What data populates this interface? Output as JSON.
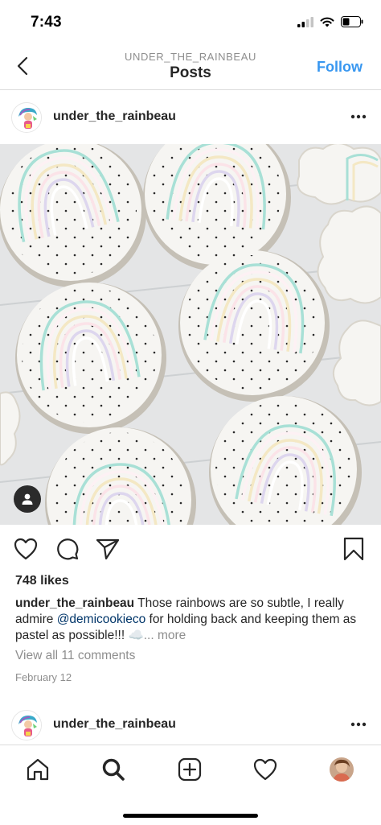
{
  "status_bar": {
    "time": "7:43"
  },
  "nav": {
    "subtitle": "UNDER_THE_RAINBEAU",
    "title": "Posts",
    "follow_label": "Follow"
  },
  "post": {
    "username": "under_the_rainbeau",
    "likes": "748 likes",
    "caption": {
      "username": "under_the_rainbeau",
      "text_before": " Those rainbows are so subtle, I really admire ",
      "mention": "@demicookieco",
      "text_after": " for holding back and keeping them as pastel as possible!!! ☁️",
      "more": "... more"
    },
    "view_comments": "View all 11 comments",
    "date": "February 12"
  },
  "next_post": {
    "username": "under_the_rainbeau"
  },
  "icons": {
    "back": "chevron-left-icon",
    "more": "more-horizontal-icon",
    "like": "heart-icon",
    "comment": "comment-icon",
    "share": "paper-plane-icon",
    "save": "bookmark-icon",
    "tag": "person-tag-icon",
    "tabs": [
      "home-icon",
      "search-icon",
      "add-post-icon",
      "activity-heart-icon",
      "profile-avatar"
    ]
  },
  "colors": {
    "accent": "#3897f0",
    "mention": "#003569",
    "muted": "#8e8e8e",
    "text": "#262626",
    "divider": "#dbdbdb"
  }
}
